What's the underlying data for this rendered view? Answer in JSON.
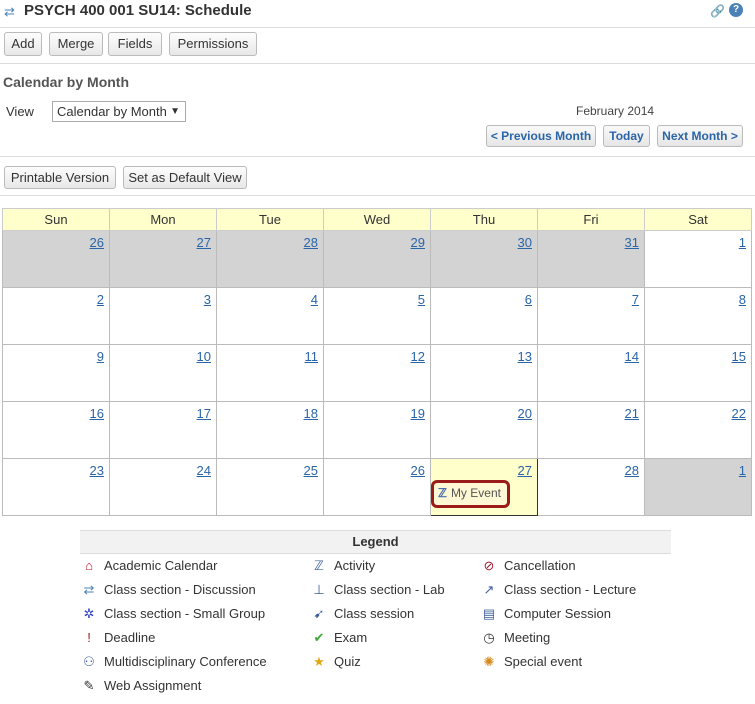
{
  "header": {
    "title": "PSYCH 400 001 SU14: Schedule"
  },
  "toolbar": {
    "add": "Add",
    "merge": "Merge",
    "fields": "Fields",
    "permissions": "Permissions"
  },
  "page": {
    "heading": "Calendar by Month",
    "view_label": "View",
    "view_selected": "Calendar by Month",
    "month_label": "February 2014",
    "prev": "< Previous Month",
    "today": "Today",
    "next": "Next Month >",
    "printable": "Printable Version",
    "default_view": "Set as Default View"
  },
  "calendar": {
    "weekdays": [
      "Sun",
      "Mon",
      "Tue",
      "Wed",
      "Thu",
      "Fri",
      "Sat"
    ],
    "weeks": [
      [
        "26",
        "27",
        "28",
        "29",
        "30",
        "31",
        "1"
      ],
      [
        "2",
        "3",
        "4",
        "5",
        "6",
        "7",
        "8"
      ],
      [
        "9",
        "10",
        "11",
        "12",
        "13",
        "14",
        "15"
      ],
      [
        "16",
        "17",
        "18",
        "19",
        "20",
        "21",
        "22"
      ],
      [
        "23",
        "24",
        "25",
        "26",
        "27",
        "28",
        "1"
      ]
    ],
    "event": {
      "label": "My Event",
      "icon": "activity-icon"
    }
  },
  "legend": {
    "title": "Legend",
    "items": [
      {
        "label": "Academic Calendar",
        "icon": "house-icon",
        "color": "#c8102e"
      },
      {
        "label": "Activity",
        "icon": "activity-icon",
        "color": "#3d5f9e"
      },
      {
        "label": "Cancellation",
        "icon": "cancel-icon",
        "color": "#9b1b30"
      },
      {
        "label": "Class section - Discussion",
        "icon": "discussion-icon",
        "color": "#4a82b8"
      },
      {
        "label": "Class section - Lab",
        "icon": "lab-icon",
        "color": "#3d5f9e"
      },
      {
        "label": "Class section - Lecture",
        "icon": "lecture-icon",
        "color": "#3d5f9e"
      },
      {
        "label": "Class section - Small Group",
        "icon": "group-icon",
        "color": "#3040c0"
      },
      {
        "label": "Class session",
        "icon": "session-icon",
        "color": "#3d5f9e"
      },
      {
        "label": "Computer Session",
        "icon": "computer-icon",
        "color": "#3d5f9e"
      },
      {
        "label": "Deadline",
        "icon": "deadline-icon",
        "color": "#9b1b1b"
      },
      {
        "label": "Exam",
        "icon": "check-icon",
        "color": "#3aa832"
      },
      {
        "label": "Meeting",
        "icon": "clock-icon",
        "color": "#333333"
      },
      {
        "label": "Multidisciplinary Conference",
        "icon": "conference-icon",
        "color": "#3d5f9e"
      },
      {
        "label": "Quiz",
        "icon": "star-icon",
        "color": "#e0a814"
      },
      {
        "label": "Special event",
        "icon": "special-event-icon",
        "color": "#d48a1a"
      },
      {
        "label": "Web Assignment",
        "icon": "web-assignment-icon",
        "color": "#333333"
      }
    ]
  }
}
